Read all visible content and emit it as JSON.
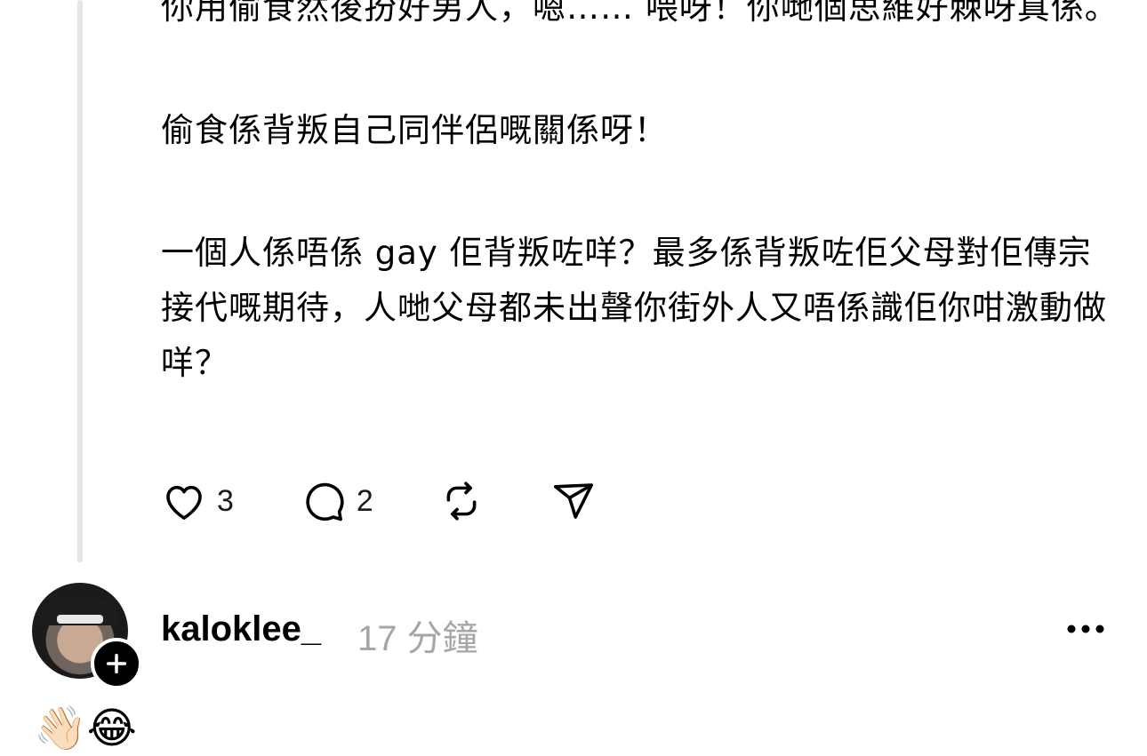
{
  "post": {
    "paragraphs": [
      "你用偷食然後扮好男人，嗯…… 喂呀！你哋個思維好棘呀真係。",
      "偷食係背叛自己同伴侶嘅關係呀！",
      "一個人係唔係 gay 佢背叛咗咩？最多係背叛咗佢父母對佢傳宗接代嘅期待，人哋父母都未出聲你街外人又唔係識佢你咁激動做咩？"
    ],
    "actions": {
      "likes": "3",
      "replies": "2"
    }
  },
  "comment": {
    "username": "kaloklee_",
    "timestamp": "17 分鐘",
    "body": "👋🏻😂"
  },
  "icons": {
    "like": "heart-icon",
    "reply": "speech-bubble-icon",
    "repost": "repost-icon",
    "share": "send-icon",
    "more": "more-dots-icon",
    "follow": "plus-icon"
  }
}
